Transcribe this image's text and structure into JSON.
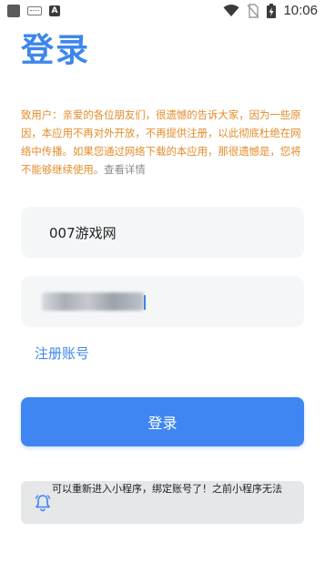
{
  "status_bar": {
    "time": "10:06",
    "left_icons": [
      "app-square-icon",
      "keyboard-icon",
      "a-letter-icon"
    ],
    "right_icons": [
      "wifi-icon",
      "no-sim-icon",
      "battery-charging-icon"
    ]
  },
  "page": {
    "title": "登录"
  },
  "notice": {
    "text": "致用户：亲爱的各位朋友们，很遗憾的告诉大家，因为一些原因，本应用不再对外开放，不再提供注册，以此彻底杜绝在网络中传播。如果您通过网络下载的本应用，那很遗憾是，您将不能够继续使用。",
    "link_text": "查看详情"
  },
  "form": {
    "username_value": "007游戏网",
    "password_masked": true
  },
  "register_link": "注册账号",
  "login_button": "登录",
  "notice_bar": {
    "text": "可以重新进入小程序，绑定账号了！之前小程序无法"
  },
  "colors": {
    "accent": "#3d86ee",
    "notice_text": "#e48c2a",
    "field_bg": "#f5f6f8",
    "notice_bar_bg": "#e6e7e9"
  }
}
